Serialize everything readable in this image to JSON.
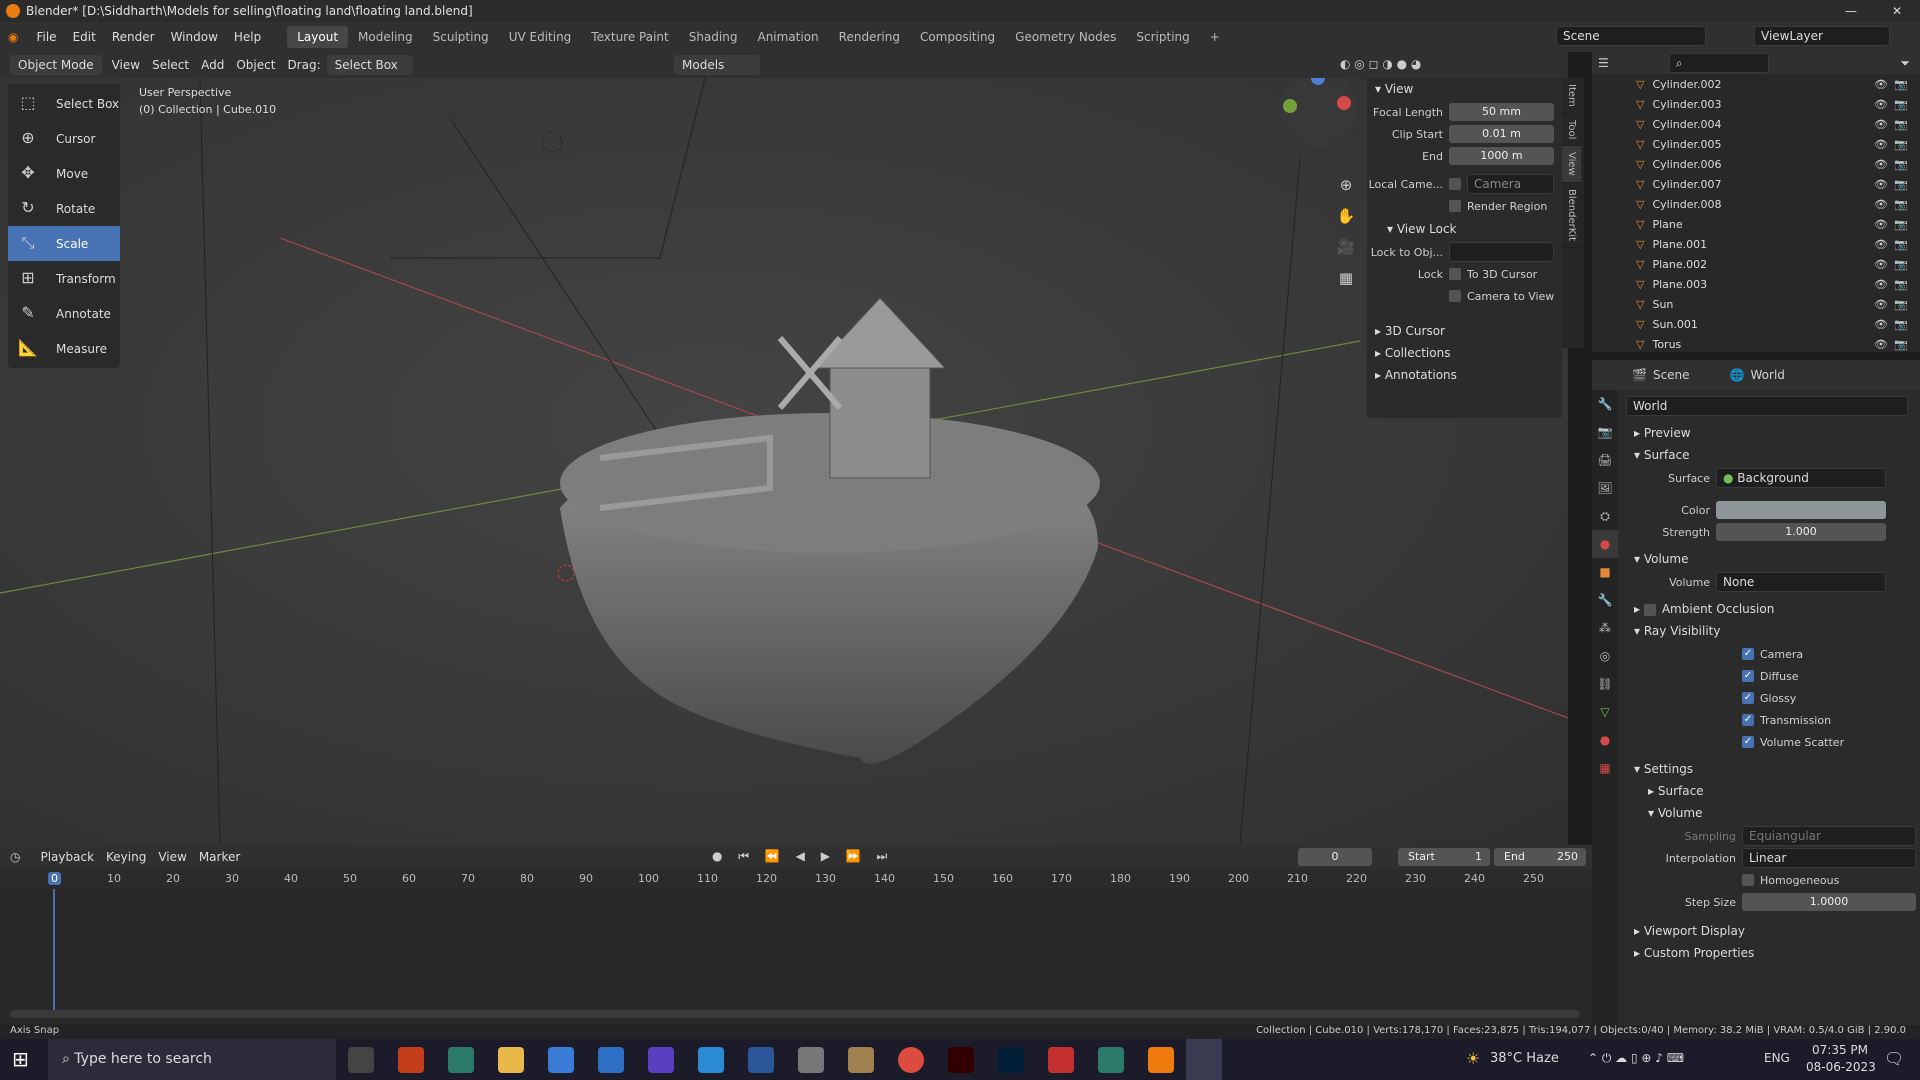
{
  "window": {
    "title": "Blender* [D:\\Siddharth\\Models for selling\\floating land\\floating land.blend]"
  },
  "menus": [
    "File",
    "Edit",
    "Render",
    "Window",
    "Help"
  ],
  "workspaces": [
    "Layout",
    "Modeling",
    "Sculpting",
    "UV Editing",
    "Texture Paint",
    "Shading",
    "Animation",
    "Rendering",
    "Compositing",
    "Geometry Nodes",
    "Scripting"
  ],
  "scene": {
    "label": "Scene",
    "view_layer": "ViewLayer"
  },
  "viewport_header": {
    "mode": "Object Mode",
    "view": "View",
    "select": "Select",
    "add": "Add",
    "object": "Object",
    "drag_label": "Drag:",
    "drag_value": "Select Box",
    "orientation": "Models"
  },
  "viewport": {
    "perspective": "User Perspective",
    "collection_info": "(0) Collection | Cube.010"
  },
  "tools": [
    "Select Box",
    "Cursor",
    "Move",
    "Rotate",
    "Scale",
    "Transform",
    "Annotate",
    "Measure"
  ],
  "active_tool": "Scale",
  "npanel": {
    "tabs": [
      "Item",
      "Tool",
      "View",
      "BlenderKit"
    ],
    "view_title": "View",
    "focal_length_label": "Focal Length",
    "focal_length": "50 mm",
    "clip_start_label": "Clip Start",
    "clip_start": "0.01 m",
    "end_label": "End",
    "end": "1000 m",
    "local_camera_label": "Local Came...",
    "local_camera_value": "Camera",
    "render_region": "Render Region",
    "view_lock_title": "View Lock",
    "lock_to_obj_label": "Lock to Obj...",
    "lock_label": "Lock",
    "to_3d_cursor": "To 3D Cursor",
    "camera_to_view": "Camera to View",
    "sections": [
      "3D Cursor",
      "Collections",
      "Annotations"
    ]
  },
  "outliner": {
    "items": [
      "Cylinder.002",
      "Cylinder.003",
      "Cylinder.004",
      "Cylinder.005",
      "Cylinder.006",
      "Cylinder.007",
      "Cylinder.008",
      "Plane",
      "Plane.001",
      "Plane.002",
      "Plane.003",
      "Sun",
      "Sun.001",
      "Torus"
    ]
  },
  "properties": {
    "tab_scene": "Scene",
    "tab_world": "World",
    "world_name": "World",
    "preview": "Preview",
    "surface_section": "Surface",
    "surface_label": "Surface",
    "surface_value": "Background",
    "color_label": "Color",
    "strength_label": "Strength",
    "strength_value": "1.000",
    "volume_section": "Volume",
    "volume_label": "Volume",
    "volume_value": "None",
    "ambient_occlusion": "Ambient Occlusion",
    "ray_visibility": "Ray Visibility",
    "ray_items": [
      "Camera",
      "Diffuse",
      "Glossy",
      "Transmission",
      "Volume Scatter"
    ],
    "settings": "Settings",
    "settings_surface": "Surface",
    "settings_volume": "Volume",
    "sampling_label": "Sampling",
    "sampling_value": "Equiangular",
    "interpolation_label": "Interpolation",
    "interpolation_value": "Linear",
    "homogeneous": "Homogeneous",
    "step_size_label": "Step Size",
    "step_size_value": "1.0000",
    "viewport_display": "Viewport Display",
    "custom_properties": "Custom Properties",
    "world_color": "#8e969a"
  },
  "timeline": {
    "menus": [
      "Playback",
      "Keying",
      "View",
      "Marker"
    ],
    "current_frame": "0",
    "start_label": "Start",
    "start": "1",
    "end_label": "End",
    "end": "250",
    "ruler": [
      "0",
      "10",
      "20",
      "30",
      "40",
      "50",
      "60",
      "70",
      "80",
      "90",
      "100",
      "110",
      "120",
      "130",
      "140",
      "150",
      "160",
      "170",
      "180",
      "190",
      "200",
      "210",
      "220",
      "230",
      "240",
      "250"
    ]
  },
  "statusbar": {
    "left": "Axis Snap",
    "right": "Collection | Cube.010 | Verts:178,170 | Faces:23,875 | Tris:194,077 | Objects:0/40 | Memory: 38.2 MiB | VRAM: 0.5/4.0 GiB | 2.90.0"
  },
  "taskbar": {
    "search_placeholder": "Type here to search",
    "weather": "38°C  Haze",
    "lang": "ENG",
    "time": "07:35 PM",
    "date": "08-06-2023"
  }
}
